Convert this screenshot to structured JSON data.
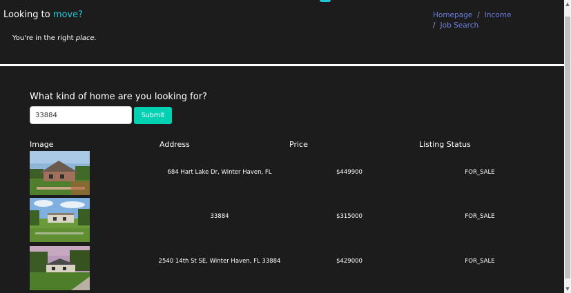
{
  "hero": {
    "heading_prefix": "Looking to ",
    "heading_accent": "move?",
    "sub_prefix": "You're in the right ",
    "sub_emphasis": "place."
  },
  "breadcrumb": {
    "items": [
      {
        "label": "Homepage"
      },
      {
        "label": "Income"
      },
      {
        "label": "Job Search"
      }
    ],
    "separator": "/"
  },
  "search": {
    "question": "What kind of home are you looking for?",
    "value": "33884",
    "submit_label": "Submit"
  },
  "table": {
    "headers": [
      "Image",
      "Address",
      "Price",
      "Listing Status"
    ],
    "rows": [
      {
        "image_icon": "house-photo",
        "address": "684 Hart Lake Dr, Winter Haven, FL",
        "price": "$449900",
        "status": "FOR_SALE"
      },
      {
        "image_icon": "house-photo",
        "address": "33884",
        "price": "$315000",
        "status": "FOR_SALE"
      },
      {
        "image_icon": "house-photo",
        "address": "2540 14th St SE, Winter Haven, FL 33884",
        "price": "$429000",
        "status": "FOR_SALE"
      }
    ]
  },
  "colors": {
    "accent": "#1fc9d8",
    "submit": "#00d1b2",
    "link": "#6b7ee0",
    "background": "#1c1c1c"
  }
}
